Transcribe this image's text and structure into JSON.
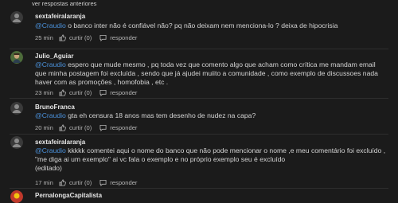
{
  "header": {
    "older_replies_link": "ver respostas anteriores"
  },
  "labels": {
    "like": "curtir (0)",
    "reply": "responder"
  },
  "comments": [
    {
      "author": "sextafeiralaranja",
      "mention": "@Craudio",
      "text": " o banco inter não é confiável não? pq não deixam nem menciona-lo ? deixa de hipocrisia",
      "time": "25 min",
      "avatar_color": "#3a3a3a"
    },
    {
      "author": "Julio_Aguiar",
      "mention": "@Craudio",
      "text": " espero que mude mesmo , pq toda vez que comento algo que acham como crítica me mandam email que minha postagem foi excluída , sendo que já ajudei muiito a comunidade , como exemplo de discussoes nada haver com as promoções , homofobia , etc .",
      "time": "23 min",
      "avatar_color": "#4d6b3a"
    },
    {
      "author": "BrunoFranca",
      "mention": "@Craudio",
      "text": " gta eh censura 18 anos mas tem desenho de nudez na capa?",
      "time": "20 min",
      "avatar_color": "#3a3a3a"
    },
    {
      "author": "sextafeiralaranja",
      "mention": "@Craudio",
      "text": " kkkkk comentei aqui o nome do banco que não pode mencionar o nome ,e meu comentário foi excluído , \"me diga ai um exemplo\" ai vc fala o exemplo e no próprio exemplo seu é excluído",
      "edited": "(editado)",
      "time": "17 min",
      "avatar_color": "#3a3a3a"
    },
    {
      "author": "PernalongaCapitalista",
      "avatar_color": "#c0392b"
    }
  ]
}
